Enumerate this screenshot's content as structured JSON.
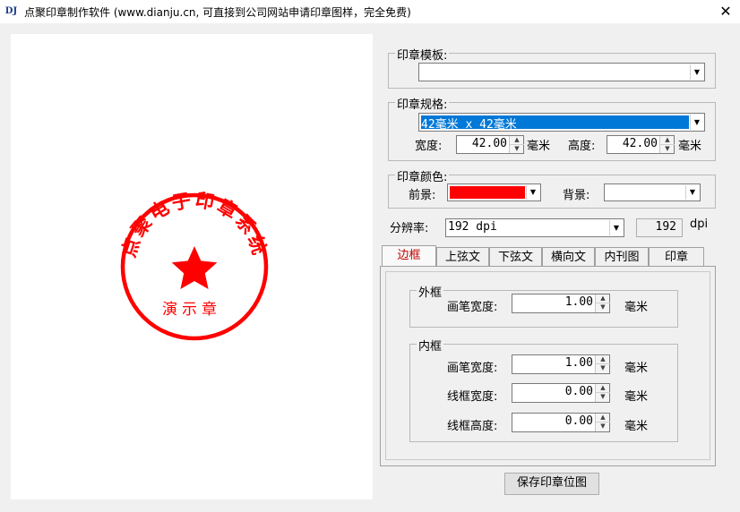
{
  "window": {
    "title": "点聚印章制作软件 (www.dianju.cn, 可直接到公司网站申请印章图样，完全免费)",
    "logo_text": "DJ",
    "close_symbol": "✕"
  },
  "seal": {
    "arc_text": "点聚电子印章系统",
    "bottom_text": "演示章",
    "color": "#ff0000"
  },
  "template": {
    "label": "印章模板:",
    "value": ""
  },
  "size": {
    "label": "印章规格:",
    "selected": "42毫米 x 42毫米",
    "width_label": "宽度:",
    "width_value": "42.00",
    "width_unit": "毫米",
    "height_label": "高度:",
    "height_value": "42.00",
    "height_unit": "毫米"
  },
  "colors": {
    "label": "印章颜色:",
    "foreground_label": "前景:",
    "foreground_color": "#ff0000",
    "background_label": "背景:",
    "background_color": "#ffffff"
  },
  "resolution": {
    "label": "分辨率:",
    "selected": "192 dpi",
    "readout": "192",
    "unit": "dpi"
  },
  "tabs": [
    {
      "label": "边框",
      "active": true
    },
    {
      "label": "上弦文",
      "active": false
    },
    {
      "label": "下弦文",
      "active": false
    },
    {
      "label": "横向文",
      "active": false
    },
    {
      "label": "内刊图",
      "active": false
    },
    {
      "label": "印章",
      "active": false
    }
  ],
  "outer_frame": {
    "title": "外框",
    "pen_width_label": "画笔宽度:",
    "pen_width_value": "1.00",
    "pen_width_unit": "毫米"
  },
  "inner_frame": {
    "title": "内框",
    "pen_width_label": "画笔宽度:",
    "pen_width_value": "1.00",
    "pen_width_unit": "毫米",
    "line_width_label": "线框宽度:",
    "line_width_value": "0.00",
    "line_width_unit": "毫米",
    "line_height_label": "线框高度:",
    "line_height_value": "0.00",
    "line_height_unit": "毫米"
  },
  "save_button": "保存印章位图"
}
